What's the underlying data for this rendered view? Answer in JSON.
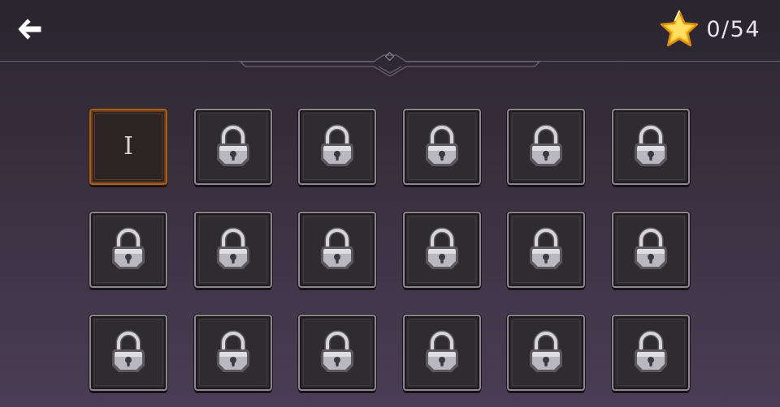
{
  "header": {
    "back_icon": "arrow-left-icon",
    "star_icon": "star-icon",
    "stars_collected": "0",
    "stars_total": "54",
    "star_counter_text": "0/54"
  },
  "levels": [
    {
      "label": "I",
      "locked": false
    },
    {
      "label": "",
      "locked": true
    },
    {
      "label": "",
      "locked": true
    },
    {
      "label": "",
      "locked": true
    },
    {
      "label": "",
      "locked": true
    },
    {
      "label": "",
      "locked": true
    },
    {
      "label": "",
      "locked": true
    },
    {
      "label": "",
      "locked": true
    },
    {
      "label": "",
      "locked": true
    },
    {
      "label": "",
      "locked": true
    },
    {
      "label": "",
      "locked": true
    },
    {
      "label": "",
      "locked": true
    },
    {
      "label": "",
      "locked": true
    },
    {
      "label": "",
      "locked": true
    },
    {
      "label": "",
      "locked": true
    },
    {
      "label": "",
      "locked": true
    },
    {
      "label": "",
      "locked": true
    },
    {
      "label": "",
      "locked": true
    }
  ],
  "colors": {
    "unlocked_border": "#a0622c",
    "locked_border": "#8a878d",
    "star_fill": "#f7c531"
  }
}
